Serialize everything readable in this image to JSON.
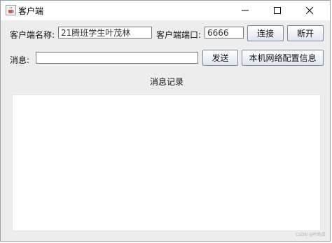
{
  "window": {
    "title": "客户端"
  },
  "form": {
    "name_label": "客户端名称:",
    "name_value": "21腾班学生叶茂林",
    "port_label": "客户端端口:",
    "port_value": "6666",
    "connect_label": "连接",
    "disconnect_label": "断开",
    "message_label": "消息:",
    "message_value": "",
    "send_label": "发送",
    "netcfg_label": "本机网络配置信息"
  },
  "log": {
    "title": "消息记录"
  },
  "watermark": "CSDN @叶韵灵",
  "icons": {
    "app": "java-cup-icon",
    "minimize": "minimize-icon",
    "maximize": "maximize-icon",
    "close": "close-icon"
  }
}
